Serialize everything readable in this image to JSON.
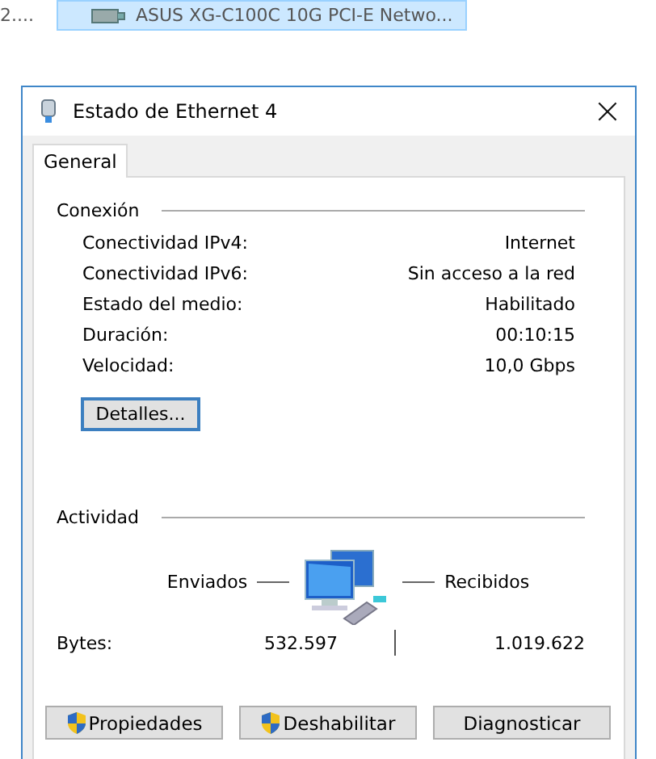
{
  "background_list": {
    "items": [
      {
        "label": "2....",
        "selected": false
      },
      {
        "label": "ASUS XG-C100C 10G PCI-E Netwo...",
        "selected": true
      }
    ]
  },
  "window": {
    "title": "Estado de Ethernet 4",
    "close": "×"
  },
  "tabs": [
    {
      "label": "General",
      "selected": true
    }
  ],
  "connection": {
    "heading": "Conexión",
    "rows": [
      {
        "label": "Conectividad IPv4:",
        "value": "Internet"
      },
      {
        "label": "Conectividad IPv6:",
        "value": "Sin acceso a la red"
      },
      {
        "label": "Estado del medio:",
        "value": "Habilitado"
      },
      {
        "label": "Duración:",
        "value": "00:10:15"
      },
      {
        "label": "Velocidad:",
        "value": "10,0 Gbps"
      }
    ],
    "details_button": "Detalles..."
  },
  "activity": {
    "heading": "Actividad",
    "sent_label": "Enviados",
    "received_label": "Recibidos",
    "bytes_label": "Bytes:",
    "bytes_sent": "532.597",
    "bytes_received": "1.019.622"
  },
  "buttons": [
    {
      "label": "Propiedades",
      "shield": true
    },
    {
      "label": "Deshabilitar",
      "shield": true
    },
    {
      "label": "Diagnosticar",
      "shield": false
    }
  ]
}
